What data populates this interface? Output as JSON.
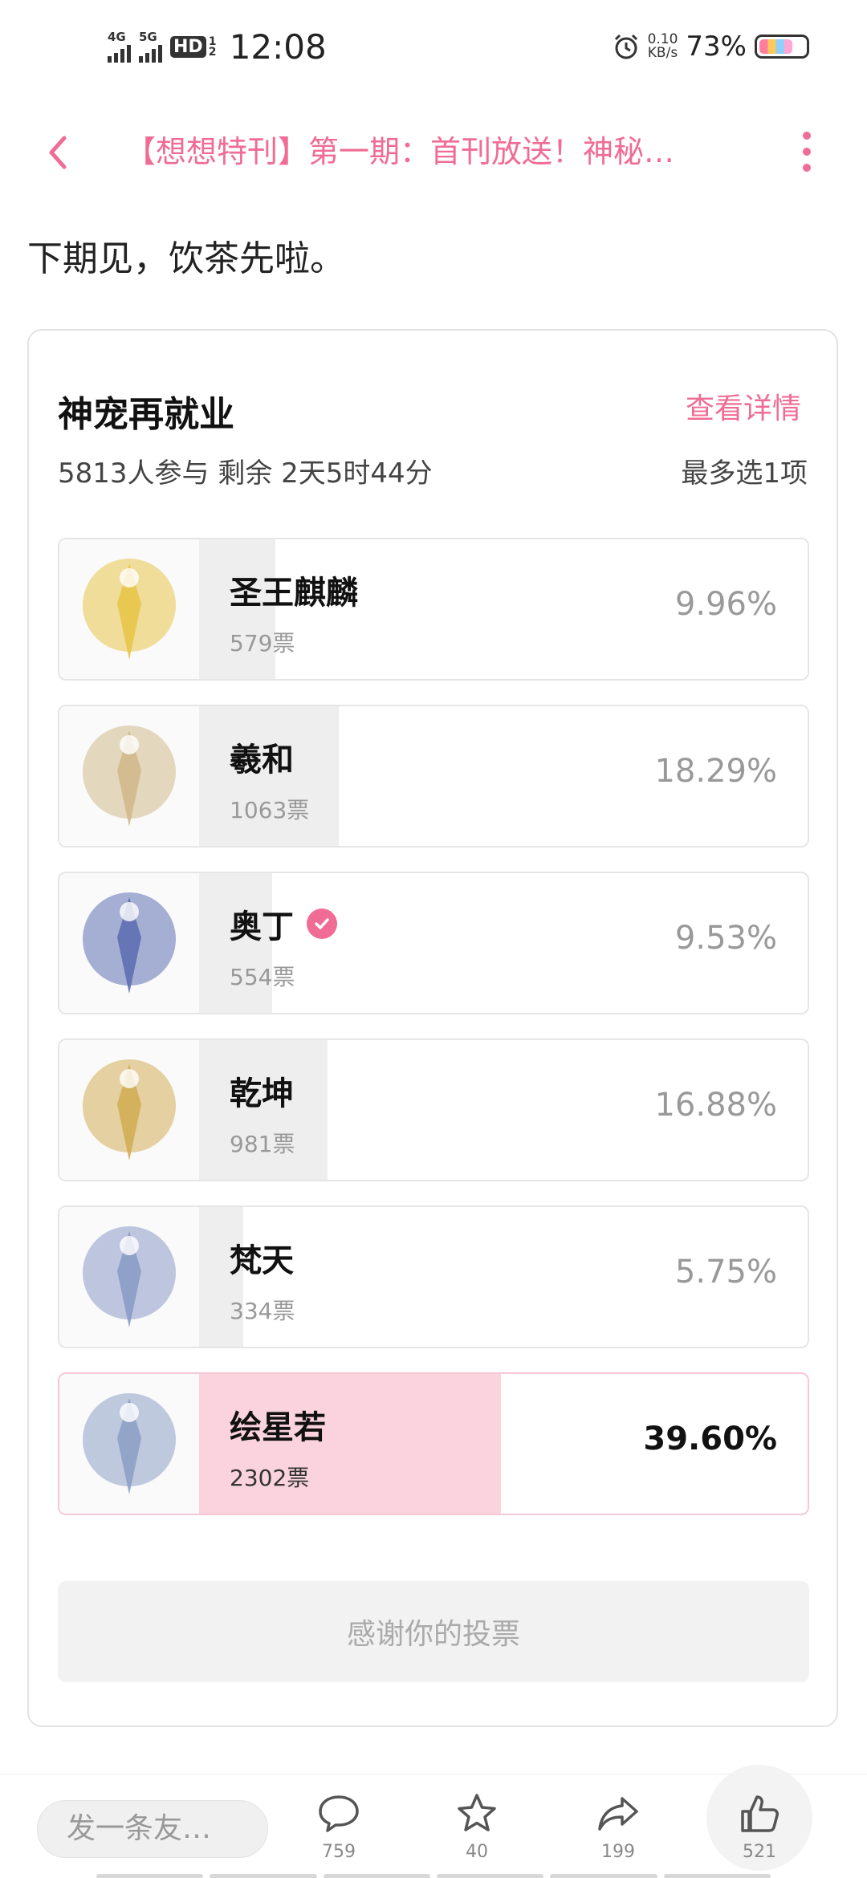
{
  "status_bar": {
    "net1": "4G",
    "net2": "5G",
    "hd": "HD",
    "hd_sub": "1 2",
    "time": "12:08",
    "speed_value": "0.10",
    "speed_unit": "KB/s",
    "battery": "73%"
  },
  "header": {
    "title": "【想想特刊】第一期：首刊放送！神秘…"
  },
  "intro_text": "下期见，饮茶先啦。",
  "poll": {
    "title": "神宠再就业",
    "detail_link": "查看详情",
    "meta": "5813人参与 剩余 2天5时44分",
    "limit": "最多选1项",
    "options": [
      {
        "name": "圣王麒麟",
        "votes": "579票",
        "percent": "9.96%",
        "share": 0.0996,
        "verified": false,
        "selected": false
      },
      {
        "name": "羲和",
        "votes": "1063票",
        "percent": "18.29%",
        "share": 0.1829,
        "verified": false,
        "selected": false
      },
      {
        "name": "奥丁",
        "votes": "554票",
        "percent": "9.53%",
        "share": 0.0953,
        "verified": true,
        "selected": false
      },
      {
        "name": "乾坤",
        "votes": "981票",
        "percent": "16.88%",
        "share": 0.1688,
        "verified": false,
        "selected": false
      },
      {
        "name": "梵天",
        "votes": "334票",
        "percent": "5.75%",
        "share": 0.0575,
        "verified": false,
        "selected": false
      },
      {
        "name": "绘星若",
        "votes": "2302票",
        "percent": "39.60%",
        "share": 0.396,
        "verified": false,
        "selected": true
      }
    ],
    "thanks": "感谢你的投票"
  },
  "bottom_bar": {
    "comment_placeholder": "发一条友…",
    "comment_count": "759",
    "star_count": "40",
    "share_count": "199",
    "like_count": "521"
  },
  "colors": {
    "accent": "#f06c95",
    "selected_bar": "#fbd3df",
    "bar": "#eeeeee"
  }
}
